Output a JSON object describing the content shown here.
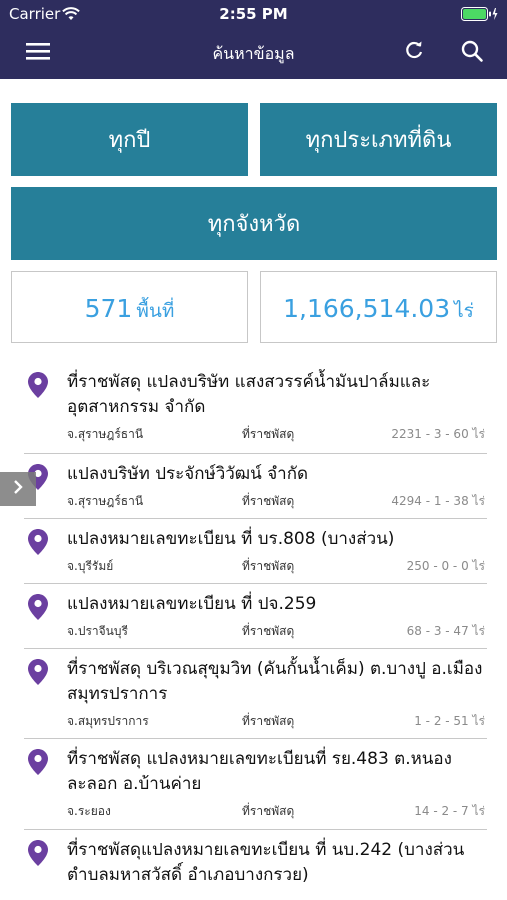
{
  "status": {
    "carrier": "Carrier",
    "time": "2:55 PM"
  },
  "nav": {
    "title": "ค้นหาข้อมูล"
  },
  "filters": {
    "year": "ทุกปี",
    "land_type": "ทุกประเภทที่ดิน",
    "province": "ทุกจังหวัด"
  },
  "stats": {
    "area_count": "571",
    "area_unit": "พื้นที่",
    "rai_total": "1,166,514.03",
    "rai_unit": "ไร่"
  },
  "items": [
    {
      "title": "ที่ราชพัสดุ แปลงบริษัท แสงสวรรค์น้ำมันปาล์มและอุตสาหกรรม จำกัด",
      "province": "จ.สุราษฎร์ธานี",
      "type": "ที่ราชพัสดุ",
      "size": "2231 - 3 - 60 ไร่"
    },
    {
      "title": "แปลงบริษัท ประจักษ์วิวัฒน์ จำกัด",
      "province": "จ.สุราษฎร์ธานี",
      "type": "ที่ราชพัสดุ",
      "size": "4294 - 1 - 38 ไร่"
    },
    {
      "title": "แปลงหมายเลขทะเบียน ที่ บร.808 (บางส่วน)",
      "province": "จ.บุรีรัมย์",
      "type": "ที่ราชพัสดุ",
      "size": "250 - 0 - 0 ไร่"
    },
    {
      "title": "แปลงหมายเลขทะเบียน ที่ ปจ.259",
      "province": "จ.ปราจีนบุรี",
      "type": "ที่ราชพัสดุ",
      "size": "68 - 3 - 47 ไร่"
    },
    {
      "title": "ที่ราชพัสดุ บริเวณสุขุมวิท (คันกั้นน้ำเค็ม) ต.บางปู อ.เมืองสมุทรปราการ",
      "province": "จ.สมุทรปราการ",
      "type": "ที่ราชพัสดุ",
      "size": "1 - 2 - 51 ไร่"
    },
    {
      "title": "ที่ราชพัสดุ แปลงหมายเลขทะเบียนที่ รย.483 ต.หนองละลอก อ.บ้านค่าย",
      "province": "จ.ระยอง",
      "type": "ที่ราชพัสดุ",
      "size": "14 - 2 - 7 ไร่"
    },
    {
      "title": "ที่ราชพัสดุแปลงหมายเลขทะเบียน ที่ นบ.242 (บางส่วน ตำบลมหาสวัสดิ์ อำเภอบางกรวย)",
      "province": "",
      "type": "",
      "size": ""
    }
  ],
  "colors": {
    "header": "#2e2d5e",
    "button": "#267f99",
    "stat_text": "#3aa0e0",
    "pin": "#6b3fa0"
  }
}
